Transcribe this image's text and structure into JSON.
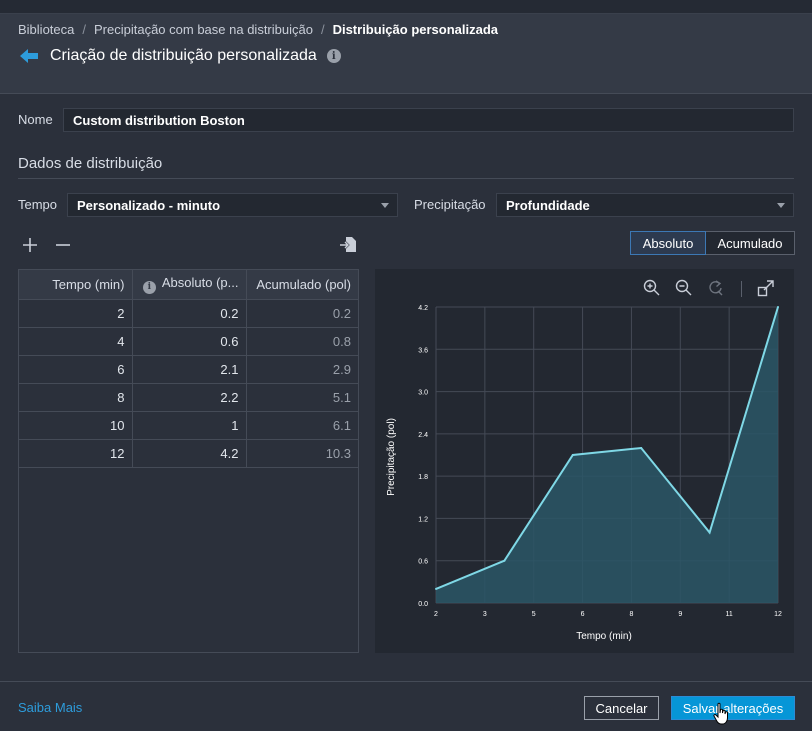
{
  "breadcrumb": {
    "items": [
      "Biblioteca",
      "Precipitação com base na distribuição",
      "Distribuição personalizada"
    ],
    "separator": "/"
  },
  "page": {
    "title": "Criação de distribuição personalizada"
  },
  "name_field": {
    "label": "Nome",
    "value": "Custom distribution Boston"
  },
  "section": {
    "title": "Dados de distribuição"
  },
  "tempo": {
    "label": "Tempo",
    "selected": "Personalizado - minuto"
  },
  "precipitacao": {
    "label": "Precipitação",
    "selected": "Profundidade"
  },
  "toggle": {
    "absoluto": "Absoluto",
    "acumulado": "Acumulado",
    "active": "Absoluto"
  },
  "table": {
    "headers": [
      "Tempo (min)",
      "Absoluto (p...",
      "Acumulado (pol)"
    ],
    "rows": [
      [
        "2",
        "0.2",
        "0.2"
      ],
      [
        "4",
        "0.6",
        "0.8"
      ],
      [
        "6",
        "2.1",
        "2.9"
      ],
      [
        "8",
        "2.2",
        "5.1"
      ],
      [
        "10",
        "1",
        "6.1"
      ],
      [
        "12",
        "4.2",
        "10.3"
      ]
    ]
  },
  "chart_data": {
    "type": "area",
    "x": [
      2,
      4,
      6,
      8,
      10,
      12
    ],
    "values": [
      0.2,
      0.6,
      2.1,
      2.2,
      1.0,
      4.2
    ],
    "xlabel": "Tempo (min)",
    "ylabel": "Precipitação (pol)",
    "xticks": [
      "2",
      "3",
      "5",
      "6",
      "8",
      "9",
      "11",
      "12"
    ],
    "yticks": [
      "0.0",
      "0.6",
      "1.2",
      "1.8",
      "2.4",
      "3.0",
      "3.6",
      "4.2"
    ],
    "ylim": [
      0,
      4.2
    ],
    "xlim": [
      2,
      12
    ],
    "grid": true,
    "line_color": "#7fd8e6",
    "fill_color": "#2a5666"
  },
  "footer": {
    "learn_more": "Saiba Mais",
    "cancel": "Cancelar",
    "save": "Salvar alterações"
  },
  "colors": {
    "accent": "#0696d7",
    "link": "#2d9cdb",
    "background": "#2b303b"
  }
}
